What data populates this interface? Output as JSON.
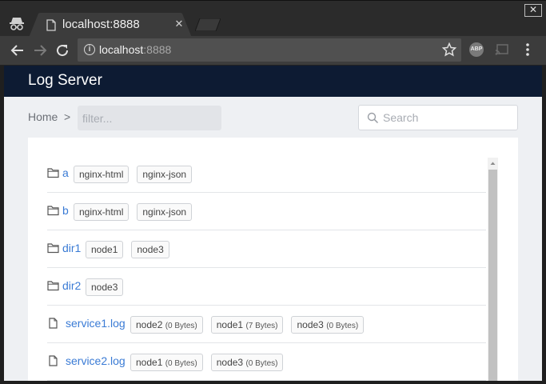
{
  "browser": {
    "tab_title": "localhost:8888",
    "tab_close": "✕",
    "window_close": "✕",
    "url_host": "localhost",
    "url_port": ":8888",
    "info_icon": "i",
    "abp_label": "ABP"
  },
  "app": {
    "brand": "Log Server",
    "breadcrumb_home": "Home",
    "breadcrumb_sep": ">",
    "filter_placeholder": "filter...",
    "search_placeholder": "Search"
  },
  "entries": [
    {
      "kind": "folder",
      "name": "a",
      "tags": [
        {
          "label": "nginx-html",
          "size": ""
        },
        {
          "label": "nginx-json",
          "size": ""
        }
      ]
    },
    {
      "kind": "folder",
      "name": "b",
      "tags": [
        {
          "label": "nginx-html",
          "size": ""
        },
        {
          "label": "nginx-json",
          "size": ""
        }
      ]
    },
    {
      "kind": "folder",
      "name": "dir1",
      "tags": [
        {
          "label": "node1",
          "size": ""
        },
        {
          "label": "node3",
          "size": ""
        }
      ]
    },
    {
      "kind": "folder",
      "name": "dir2",
      "tags": [
        {
          "label": "node3",
          "size": ""
        }
      ]
    },
    {
      "kind": "file",
      "name": "service1.log",
      "tags": [
        {
          "label": "node2",
          "size": "(0 Bytes)"
        },
        {
          "label": "node1",
          "size": "(7 Bytes)"
        },
        {
          "label": "node3",
          "size": "(0 Bytes)"
        }
      ]
    },
    {
      "kind": "file",
      "name": "service2.log",
      "tags": [
        {
          "label": "node1",
          "size": "(0 Bytes)"
        },
        {
          "label": "node3",
          "size": "(0 Bytes)"
        }
      ]
    }
  ],
  "colors": {
    "navbar": "#0d1b33",
    "link": "#3a7bd5",
    "page_bg": "#eef0f3"
  }
}
